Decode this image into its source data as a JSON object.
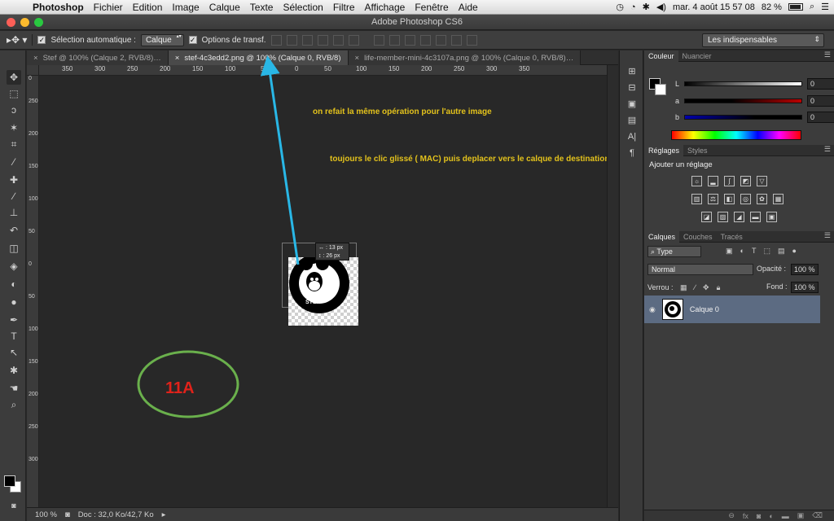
{
  "menubar": {
    "app_name": "Photoshop",
    "items": [
      "Fichier",
      "Edition",
      "Image",
      "Calque",
      "Texte",
      "Sélection",
      "Filtre",
      "Affichage",
      "Fenêtre",
      "Aide"
    ],
    "datetime": "mar. 4 août  15 57 08",
    "battery": "82 %"
  },
  "window": {
    "title": "Adobe Photoshop CS6"
  },
  "options": {
    "auto_select_label": "Sélection automatique :",
    "auto_select_value": "Calque",
    "transform_label": "Options de transf.",
    "workspace": "Les indispensables"
  },
  "tabs": [
    {
      "label": "Stef @ 100% (Calque 2, RVB/8)…",
      "active": false
    },
    {
      "label": "stef-4c3edd2.png @ 100% (Calque 0, RVB/8)",
      "active": true
    },
    {
      "label": "life-member-mini-4c3107a.png @ 100% (Calque 0, RVB/8)…",
      "active": false
    }
  ],
  "ruler": {
    "top_labels": [
      "350",
      "300",
      "250",
      "200",
      "150",
      "100",
      "50",
      "0",
      "50",
      "100",
      "150",
      "200",
      "250",
      "300",
      "350"
    ]
  },
  "canvas": {
    "annotation1": "on refait la même opération pour l'autre image",
    "annotation2": "toujours le clic glissé ( MAC) puis deplacer vers le calque de destination",
    "step_label": "11A",
    "tooltip_x": "↔ : 13 px",
    "tooltip_y": "↕ : 26 px",
    "logo_text": "STEF MIDIMOTORCYCLES"
  },
  "status": {
    "zoom": "100 %",
    "doc": "Doc : 32,0 Ko/42,7 Ko"
  },
  "color_panel": {
    "tabs": [
      "Couleur",
      "Nuancier"
    ],
    "sliders": [
      {
        "label": "L",
        "value": "0"
      },
      {
        "label": "a",
        "value": "0"
      },
      {
        "label": "b",
        "value": "0"
      }
    ]
  },
  "adjust_panel": {
    "tabs": [
      "Réglages",
      "Styles"
    ],
    "heading": "Ajouter un réglage"
  },
  "layers_panel": {
    "tabs": [
      "Calques",
      "Couches",
      "Tracés"
    ],
    "filter": "Type",
    "blend_mode": "Normal",
    "opacity_label": "Opacité :",
    "opacity": "100 %",
    "lock_label": "Verrou :",
    "fill_label": "Fond :",
    "fill": "100 %",
    "layer_name": "Calque 0"
  },
  "colors": {
    "accent_arrow": "#29b7e6",
    "circle": "#6ab04c",
    "annotation": "#e3c21c",
    "step": "#e0221a"
  }
}
